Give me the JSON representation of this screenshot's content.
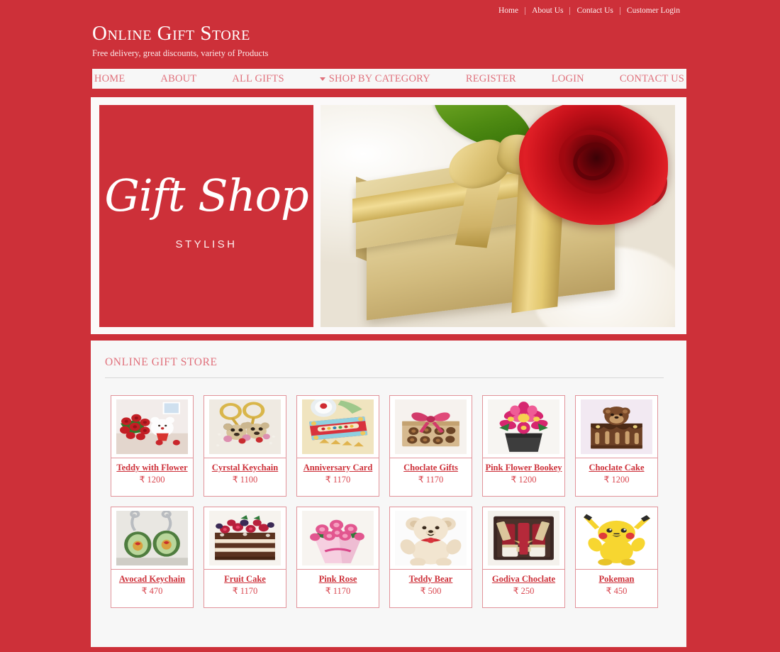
{
  "topbar": {
    "links": [
      {
        "label": "Home"
      },
      {
        "label": "About Us"
      },
      {
        "label": "Contact Us"
      },
      {
        "label": "Customer Login"
      }
    ]
  },
  "brand": {
    "title": "Online Gift Store",
    "tagline": "Free delivery, great discounts, variety of Products"
  },
  "mainnav": {
    "items": [
      {
        "label": "HOME",
        "has_caret": false
      },
      {
        "label": "ABOUT",
        "has_caret": false
      },
      {
        "label": "ALL GIFTS",
        "has_caret": false
      },
      {
        "label": "SHOP BY CATEGORY",
        "has_caret": true
      },
      {
        "label": "REGISTER",
        "has_caret": false
      },
      {
        "label": "LOGIN",
        "has_caret": false
      },
      {
        "label": "CONTACT US",
        "has_caret": false
      }
    ]
  },
  "banner": {
    "left": {
      "script_text": "Gift Shop",
      "sub_text": "STYLISH"
    },
    "right": {
      "alt": "gold-gift-box-with-red-rose"
    }
  },
  "section": {
    "title": "ONLINE GIFT STORE"
  },
  "products": [
    {
      "name": "Teddy with Flower",
      "price": "₹ 1200",
      "image": "teddy-with-flower"
    },
    {
      "name": "Cyrstal Keychain",
      "price": "₹ 1100",
      "image": "crystal-keychain"
    },
    {
      "name": "Anniversary Card",
      "price": "₹ 1170",
      "image": "anniversary-card"
    },
    {
      "name": "Choclate Gifts",
      "price": "₹ 1170",
      "image": "chocolate-gifts"
    },
    {
      "name": "Pink Flower Bookey",
      "price": "₹ 1200",
      "image": "pink-flower-bouquet"
    },
    {
      "name": "Choclate Cake",
      "price": "₹ 1200",
      "image": "chocolate-cake"
    },
    {
      "name": "Avocad Keychain",
      "price": "₹ 470",
      "image": "avocado-keychain"
    },
    {
      "name": "Fruit Cake",
      "price": "₹ 1170",
      "image": "fruit-cake"
    },
    {
      "name": "Pink Rose",
      "price": "₹ 1170",
      "image": "pink-rose-bouquet"
    },
    {
      "name": "Teddy Bear",
      "price": "₹ 500",
      "image": "teddy-bear"
    },
    {
      "name": "Godiva Choclate",
      "price": "₹ 250",
      "image": "godiva-chocolate"
    },
    {
      "name": "Pokeman",
      "price": "₹ 450",
      "image": "pikachu-plush"
    }
  ],
  "colors": {
    "brand_red": "#cd3039",
    "panel_bg": "#f7f7f7",
    "link_red": "#cd3039",
    "nav_link": "#e0707b",
    "card_border": "#e2939a"
  }
}
